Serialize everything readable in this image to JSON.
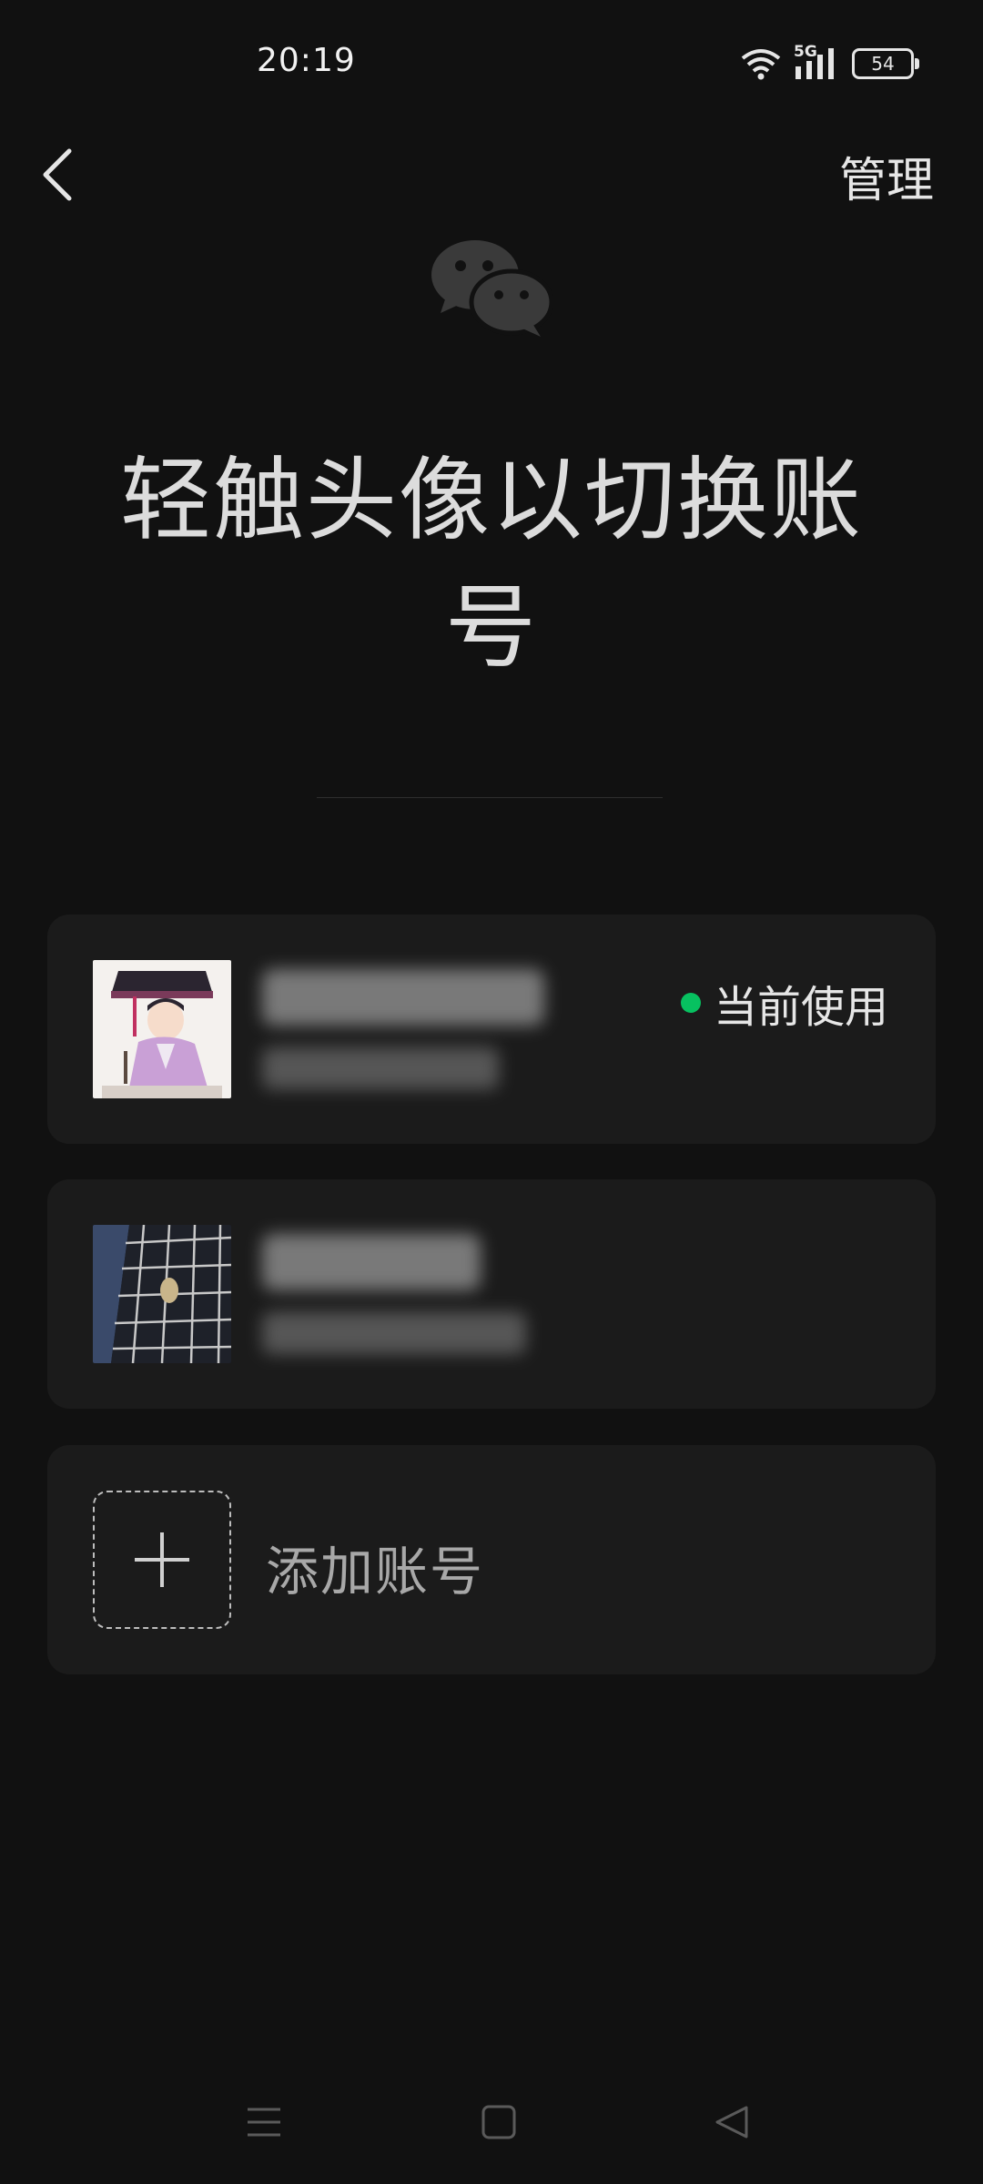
{
  "status_bar": {
    "time": "20:19",
    "network": "5G",
    "battery": "54"
  },
  "top_bar": {
    "manage_label": "管理"
  },
  "page_title": "轻触头像以切换账号",
  "accounts": [
    {
      "current_label": "当前使用"
    },
    {}
  ],
  "add_account": {
    "label": "添加账号"
  },
  "colors": {
    "background": "#111111",
    "card": "#1b1b1b",
    "accent_green": "#07c160"
  },
  "icons": [
    "back-arrow-icon",
    "wechat-logo-icon",
    "wifi-icon",
    "signal-icon",
    "battery-icon",
    "plus-icon",
    "menu-icon",
    "home-icon",
    "back-triangle-icon"
  ]
}
